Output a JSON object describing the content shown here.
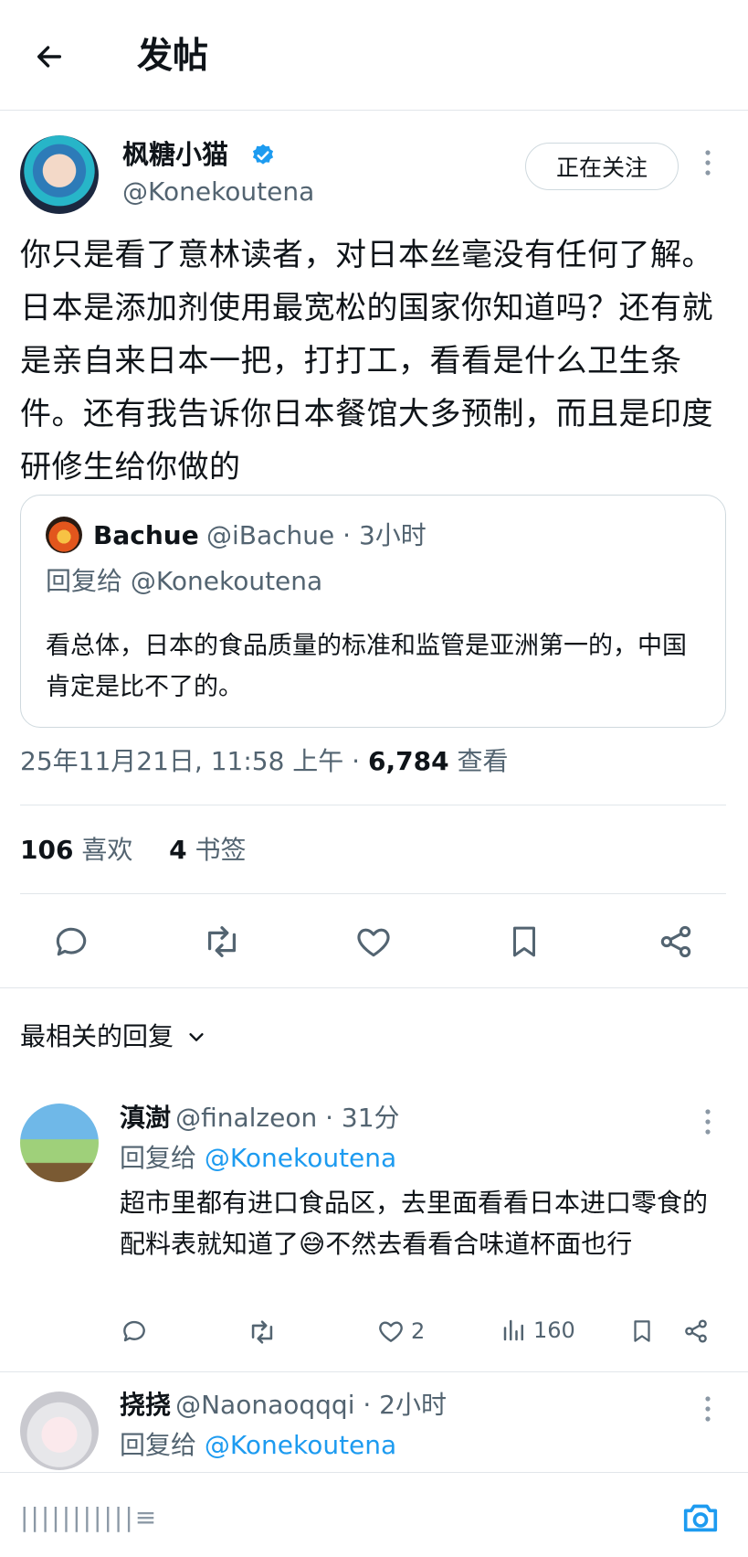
{
  "header": {
    "title": "发帖",
    "back_icon": "arrow-left-icon"
  },
  "author": {
    "name": "枫糖小猫",
    "handle": "@Konekoutena",
    "verified": true,
    "follow_label": "正在关注"
  },
  "tweet": {
    "text": "你只是看了意林读者，对日本丝毫没有任何了解。日本是添加剂使用最宽松的国家你知道吗？还有就是亲自来日本一把，打打工，看看是什么卫生条件。还有我告诉你日本餐馆大多预制，而且是印度研修生给你做的",
    "timestamp": "25年11月21日, 11:58 上午 · ",
    "views_count": "6,784",
    "views_label": " 查看",
    "likes_count": "106",
    "likes_label": " 喜欢",
    "bookmarks_count": "4",
    "bookmarks_label": " 书签"
  },
  "quote": {
    "name": "Bachue",
    "meta": "@iBachue · 3小时",
    "reply_to": "回复给 @Konekoutena",
    "text": "看总体，日本的食品质量的标准和监管是亚洲第一的，中国肯定是比不了的。"
  },
  "sort": {
    "label": "最相关的回复"
  },
  "replies": [
    {
      "name": "滇澍",
      "meta": "@finalzeon · 31分",
      "reply_prefix": "回复给 ",
      "reply_handle": "@Konekoutena",
      "text": "超市里都有进口食品区，去里面看看日本进口零食的配料表就知道了😅不然去看看合味道杯面也行",
      "likes": "2",
      "views": "160"
    },
    {
      "name": "挠挠",
      "meta": "@Naonaoqqqi · 2小时",
      "reply_prefix": "回复给 ",
      "reply_handle": "@Konekoutena"
    }
  ],
  "composer": {
    "placeholder": "|||||||||||≡"
  },
  "colors": {
    "accent": "#1d9bf0",
    "text": "#0f1419",
    "secondary": "#536471",
    "border": "#cfd9de"
  }
}
